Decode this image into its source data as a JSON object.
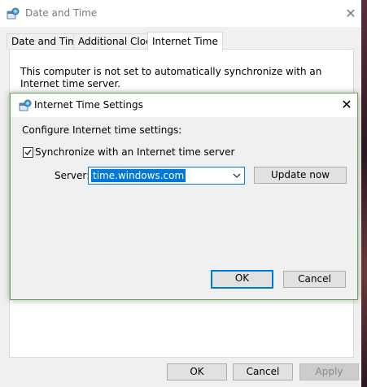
{
  "main_window": {
    "title": "Date and Time",
    "tabs": [
      "Date and Time",
      "Additional Clocks",
      "Internet Time"
    ],
    "active_tab": "Internet Time",
    "status_text": "This computer is not set to automatically synchronize with an Internet time server.",
    "buttons": {
      "ok": "OK",
      "cancel": "Cancel",
      "apply": "Apply"
    }
  },
  "dialog": {
    "title": "Internet Time Settings",
    "heading": "Configure Internet time settings:",
    "sync_checkbox_label": "Synchronize with an Internet time server",
    "sync_checked": true,
    "server_label": "Server:",
    "server_value": "time.windows.com",
    "update_button": "Update now",
    "ok_button": "OK",
    "cancel_button": "Cancel"
  },
  "colors": {
    "accent": "#0078d7",
    "dialog_border": "#6aa84f",
    "window_bg": "#f0f0f0"
  },
  "icons": {
    "window_icon": "date-time-globe-icon",
    "close": "close-icon",
    "dropdown": "chevron-down-icon",
    "check": "checkmark-icon"
  }
}
